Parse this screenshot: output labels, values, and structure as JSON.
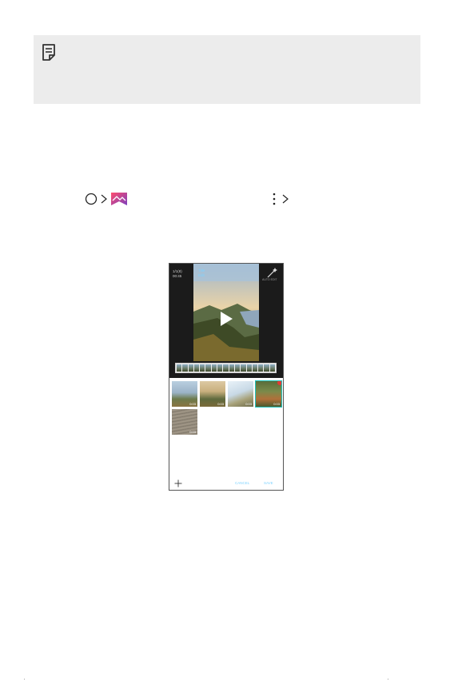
{
  "note": {
    "icon": "note-icon"
  },
  "nav": {
    "icons": [
      "home-icon",
      "chevron-right-icon",
      "gallery-icon",
      "more-options-icon",
      "chevron-right-icon"
    ]
  },
  "phone_screen": {
    "header": {
      "info_line1": "1/1(8)",
      "info_line2": "00:45",
      "title_line1": "Title",
      "title_line2": "Edit",
      "magic_label": "AUTO EDIT"
    },
    "timeline_frames": 17,
    "clips": [
      {
        "duration": "0:03",
        "selected": false
      },
      {
        "duration": "0:03",
        "selected": false
      },
      {
        "duration": "0:03",
        "selected": false
      },
      {
        "duration": "0:03",
        "selected": true
      },
      {
        "duration": "0:03",
        "selected": false
      }
    ],
    "buttons": {
      "cancel": "CANCEL",
      "save": "SAVE"
    }
  },
  "colors": {
    "accent": "#7fd3ff",
    "selection": "#22c4c0",
    "delete_badge": "#e53935",
    "note_bg": "#ececec"
  }
}
